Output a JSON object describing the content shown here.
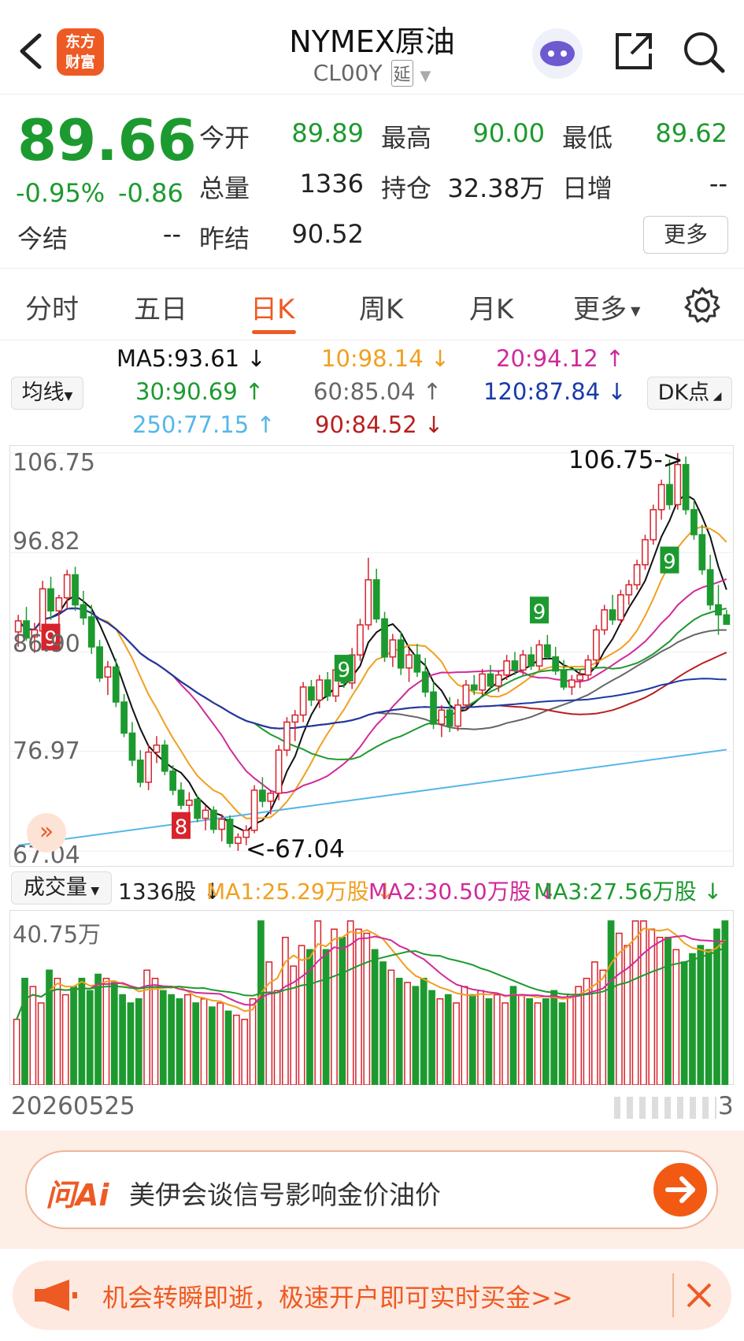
{
  "header": {
    "title": "NYMEX原油",
    "code": "CL00Y",
    "delay_badge": "延",
    "logo_lines": [
      "东方",
      "财富"
    ]
  },
  "quote": {
    "price": "89.66",
    "change_pct": "-0.95%",
    "change": "-0.86",
    "fields": [
      {
        "label": "今开",
        "value": "89.89"
      },
      {
        "label": "最高",
        "value": "90.00"
      },
      {
        "label": "最低",
        "value": "89.62"
      },
      {
        "label": "总量",
        "value": "1336"
      },
      {
        "label": "持仓",
        "value": "32.38万"
      },
      {
        "label": "日增",
        "value": "--"
      },
      {
        "label": "今结",
        "value": "--"
      },
      {
        "label": "昨结",
        "value": "90.52"
      }
    ],
    "more_label": "更多"
  },
  "tabs": [
    "分时",
    "五日",
    "日K",
    "周K",
    "月K",
    "更多"
  ],
  "ma_legend": {
    "selector_label": "均线",
    "dk_label": "DK点",
    "ma5": "MA5:93.61 ↓",
    "ma10": "10:98.14 ↓",
    "ma20": "20:94.12 ↑",
    "ma30": "30:90.69 ↑",
    "ma60": "60:85.04 ↑",
    "ma120": "120:87.84 ↓",
    "ma250": "250:77.15 ↑",
    "ma90": "90:84.52 ↓"
  },
  "chart_data": {
    "type": "candlestick",
    "y_ticks": [
      "106.75",
      "96.82",
      "86.90",
      "76.97",
      "67.04"
    ],
    "ylim": [
      67.04,
      106.75
    ],
    "annotations": {
      "high": "106.75->",
      "low": "<-67.04"
    },
    "date_label": "20260525",
    "date_label_right": "3",
    "candles": [
      [
        88.9,
        90.6,
        87.4,
        90.0
      ],
      [
        90.0,
        91.4,
        88.0,
        88.3
      ],
      [
        88.4,
        89.8,
        86.8,
        89.1
      ],
      [
        89.0,
        94.0,
        88.6,
        93.2
      ],
      [
        93.2,
        94.4,
        90.1,
        91.0
      ],
      [
        91.0,
        92.6,
        89.3,
        92.3
      ],
      [
        92.3,
        95.1,
        91.2,
        94.6
      ],
      [
        94.6,
        95.4,
        91.0,
        91.6
      ],
      [
        91.6,
        93.0,
        89.6,
        90.3
      ],
      [
        90.4,
        91.6,
        86.7,
        87.4
      ],
      [
        87.4,
        88.1,
        83.9,
        84.3
      ],
      [
        84.4,
        86.0,
        82.6,
        85.4
      ],
      [
        85.4,
        86.2,
        81.4,
        81.9
      ],
      [
        81.9,
        82.7,
        78.4,
        78.8
      ],
      [
        78.8,
        79.9,
        75.5,
        76.1
      ],
      [
        76.1,
        77.1,
        73.4,
        73.9
      ],
      [
        73.9,
        77.6,
        73.1,
        76.9
      ],
      [
        76.9,
        78.5,
        75.8,
        77.6
      ],
      [
        77.6,
        78.1,
        74.6,
        75.0
      ],
      [
        75.0,
        75.6,
        72.6,
        73.1
      ],
      [
        73.1,
        73.9,
        71.2,
        71.6
      ],
      [
        71.6,
        72.9,
        70.6,
        72.1
      ],
      [
        72.2,
        72.6,
        69.9,
        70.3
      ],
      [
        70.3,
        71.6,
        69.1,
        71.1
      ],
      [
        71.1,
        71.5,
        68.8,
        69.2
      ],
      [
        69.2,
        70.7,
        68.0,
        70.2
      ],
      [
        70.2,
        70.6,
        67.4,
        67.8
      ],
      [
        67.8,
        68.8,
        67.04,
        68.4
      ],
      [
        68.4,
        69.6,
        67.6,
        69.1
      ],
      [
        69.1,
        73.6,
        68.8,
        73.1
      ],
      [
        73.1,
        74.4,
        71.4,
        72.0
      ],
      [
        72.0,
        73.1,
        70.7,
        72.8
      ],
      [
        72.8,
        77.6,
        72.1,
        77.1
      ],
      [
        77.1,
        80.4,
        76.5,
        79.9
      ],
      [
        79.9,
        81.1,
        78.0,
        80.6
      ],
      [
        80.6,
        83.9,
        79.9,
        83.4
      ],
      [
        83.4,
        84.1,
        81.5,
        82.1
      ],
      [
        82.1,
        84.6,
        81.3,
        84.1
      ],
      [
        84.1,
        84.9,
        82.0,
        82.5
      ],
      [
        82.5,
        85.6,
        81.9,
        85.1
      ],
      [
        85.1,
        86.1,
        83.3,
        83.8
      ],
      [
        83.8,
        87.3,
        83.2,
        86.6
      ],
      [
        86.6,
        90.2,
        86.0,
        89.6
      ],
      [
        89.6,
        96.3,
        89.1,
        94.1
      ],
      [
        94.1,
        95.2,
        89.8,
        90.2
      ],
      [
        90.2,
        90.9,
        85.9,
        86.4
      ],
      [
        86.4,
        88.7,
        85.4,
        88.1
      ],
      [
        88.1,
        88.9,
        84.6,
        85.3
      ],
      [
        85.3,
        87.2,
        83.9,
        86.6
      ],
      [
        86.6,
        87.7,
        84.4,
        84.9
      ],
      [
        84.9,
        86.3,
        82.4,
        82.9
      ],
      [
        82.9,
        83.9,
        79.2,
        79.7
      ],
      [
        79.7,
        81.6,
        78.4,
        81.1
      ],
      [
        81.1,
        82.4,
        78.9,
        79.5
      ],
      [
        79.5,
        82.2,
        79.0,
        81.6
      ],
      [
        81.6,
        84.1,
        81.1,
        83.6
      ],
      [
        83.6,
        84.6,
        82.6,
        83.1
      ],
      [
        83.1,
        85.2,
        82.6,
        84.7
      ],
      [
        84.7,
        85.6,
        83.1,
        83.5
      ],
      [
        83.5,
        85.1,
        82.9,
        84.6
      ],
      [
        84.6,
        86.6,
        84.1,
        86.0
      ],
      [
        86.0,
        86.9,
        84.6,
        85.1
      ],
      [
        85.1,
        87.1,
        84.6,
        86.6
      ],
      [
        86.6,
        87.4,
        85.1,
        85.5
      ],
      [
        85.5,
        88.1,
        85.1,
        87.6
      ],
      [
        87.6,
        88.6,
        86.1,
        86.4
      ],
      [
        86.4,
        87.4,
        84.6,
        85.0
      ],
      [
        85.0,
        86.1,
        83.1,
        83.4
      ],
      [
        83.4,
        84.6,
        82.6,
        84.1
      ],
      [
        84.1,
        85.1,
        83.3,
        84.6
      ],
      [
        84.6,
        86.6,
        84.1,
        86.1
      ],
      [
        86.1,
        89.6,
        85.6,
        89.1
      ],
      [
        89.1,
        91.6,
        88.6,
        91.1
      ],
      [
        91.1,
        92.6,
        89.6,
        90.1
      ],
      [
        90.1,
        93.1,
        89.6,
        92.6
      ],
      [
        92.6,
        94.1,
        91.6,
        93.6
      ],
      [
        93.6,
        96.1,
        93.1,
        95.6
      ],
      [
        95.6,
        98.6,
        95.1,
        98.1
      ],
      [
        98.1,
        101.6,
        97.6,
        101.1
      ],
      [
        101.1,
        104.1,
        100.1,
        103.6
      ],
      [
        103.6,
        106.1,
        101.1,
        101.6
      ],
      [
        101.6,
        106.75,
        101.1,
        105.6
      ],
      [
        105.6,
        106.4,
        100.6,
        101.1
      ],
      [
        101.1,
        102.1,
        98.1,
        98.6
      ],
      [
        98.6,
        99.6,
        94.6,
        95.1
      ],
      [
        95.1,
        96.6,
        91.1,
        91.6
      ],
      [
        91.6,
        93.6,
        88.6,
        90.6
      ],
      [
        90.6,
        91.1,
        89.6,
        89.66
      ]
    ],
    "ma_colors": {
      "ma5": "#111111",
      "ma10": "#f0a020",
      "ma20": "#d02a9a",
      "ma30": "#1d9a2f",
      "ma60": "#666666",
      "ma120": "#1a3aa8",
      "ma250": "#55b7e8",
      "ma90": "#b82020"
    },
    "volume": {
      "label": "成交量",
      "shares": "1336股 ↓",
      "ma1": "MA1:25.29万股 ↓",
      "ma2": "MA2:30.50万股 ↓",
      "ma3": "MA3:27.56万股 ↓",
      "y_tick": "40.75万",
      "ymax": 40.75,
      "values": [
        16,
        26,
        24,
        20,
        28,
        26,
        22,
        24,
        26,
        23,
        27,
        26,
        25,
        22,
        20,
        21,
        28,
        26,
        23,
        22,
        21,
        22,
        20,
        21,
        19,
        20,
        18,
        17,
        16,
        21,
        40,
        30,
        23,
        36,
        29,
        34,
        33,
        40,
        33,
        38,
        36,
        40,
        38,
        37,
        33,
        30,
        28,
        26,
        25,
        24,
        26,
        23,
        21,
        22,
        20,
        24,
        22,
        23,
        21,
        22,
        20,
        24,
        22,
        21,
        20,
        21,
        23,
        20,
        22,
        24,
        26,
        30,
        28,
        40,
        37,
        34,
        40,
        40,
        38,
        36,
        36,
        33,
        30,
        32,
        34,
        33,
        38,
        40
      ]
    }
  },
  "dk_marks": [
    "9",
    "8",
    "9",
    "9",
    "9"
  ],
  "ai": {
    "brand": "问Ai",
    "text": "美伊会谈信号影响金价油价"
  },
  "promo": {
    "text": "机会转瞬即逝，极速开户即可实时买金>>"
  }
}
